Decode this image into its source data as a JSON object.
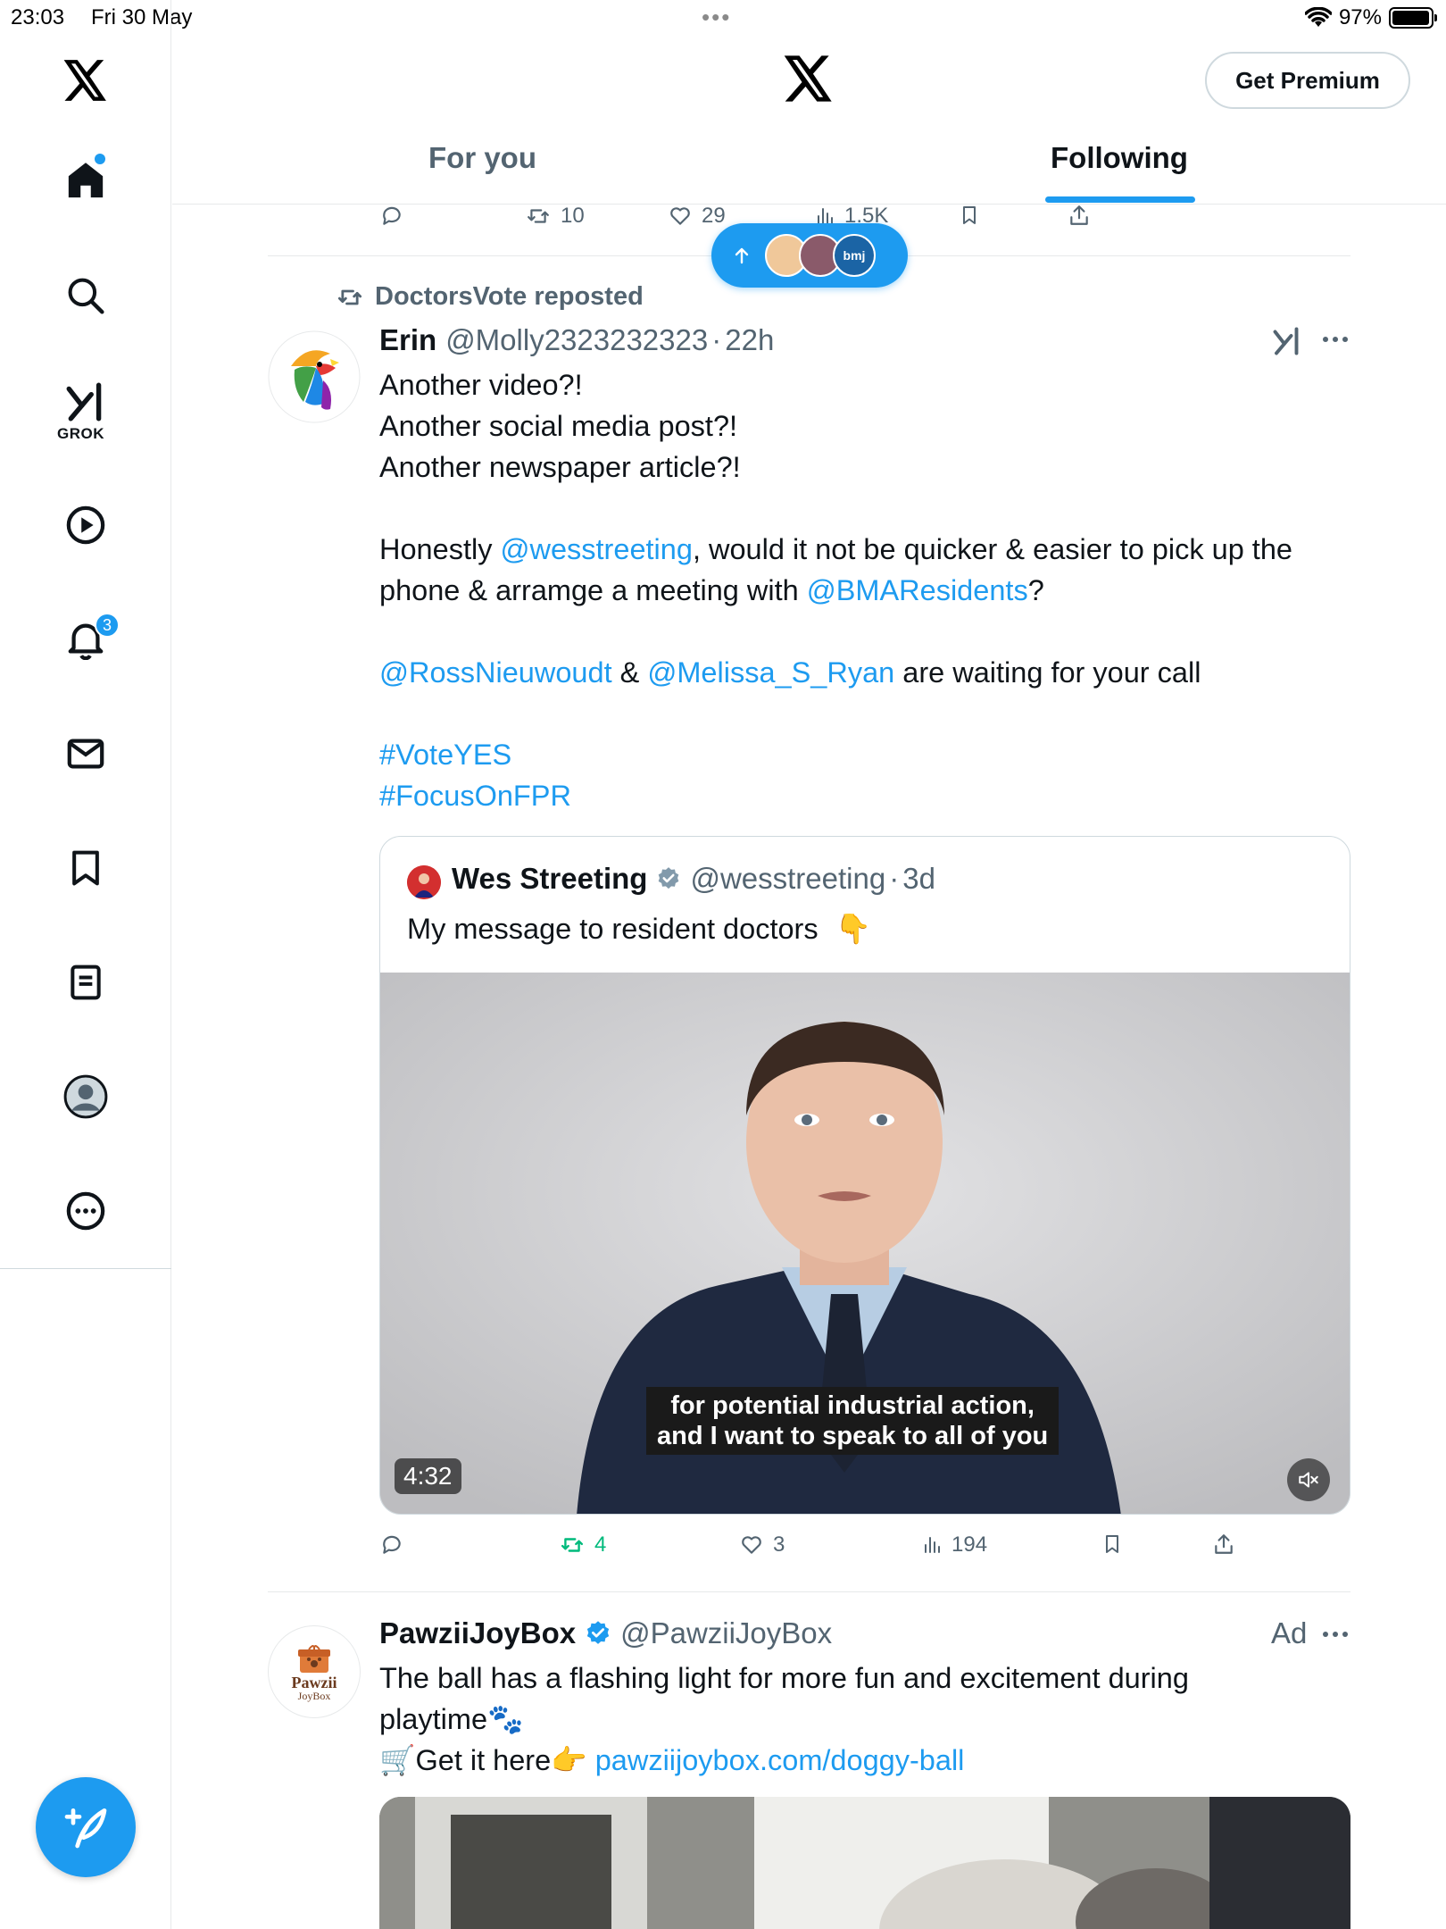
{
  "status_bar": {
    "time": "23:03",
    "date": "Fri 30 May",
    "dots": "•••",
    "battery": "97%",
    "battery_level": 0.97
  },
  "header": {
    "premium_label": "Get Premium",
    "tabs": [
      {
        "label": "For you",
        "active": false
      },
      {
        "label": "Following",
        "active": true
      }
    ]
  },
  "sidebar": {
    "grok_label": "GROK",
    "notifications_badge": "3",
    "items": [
      "home-icon",
      "search-icon",
      "grok-icon",
      "video-icon",
      "bell-icon",
      "mail-icon",
      "bookmark-icon",
      "lists-icon",
      "profile-icon",
      "more-icon"
    ]
  },
  "previous_post_actions": {
    "retweets": "10",
    "likes": "29",
    "views": "1.5K"
  },
  "new_posts_pill": {
    "avatar_text": "bmj"
  },
  "post1": {
    "repost_by": "DoctorsVote reposted",
    "name": "Erin",
    "handle": "@Molly2323232323",
    "sep": "·",
    "time": "22h",
    "lines": {
      "l1": "Another video?!",
      "l2": "Another social media post?!",
      "l3": "Another newspaper article?!",
      "p2a": "Honestly ",
      "mention1": "@wesstreeting",
      "p2b": ", would it not be quicker & easier to pick up the",
      "p2c": "phone & arramge a meeting with ",
      "mention2": "@BMAResidents",
      "p2d": "?",
      "mention3": "@RossNieuwoudt",
      "amp": " & ",
      "mention4": "@Melissa_S_Ryan",
      "p3": " are waiting for your call",
      "tag1": "#VoteYES",
      "tag2": "#FocusOnFPR"
    },
    "quote": {
      "name": "Wes Streeting",
      "handle": "@wesstreeting",
      "sep": "·",
      "time": "3d",
      "text": "My message to resident doctors",
      "emoji": "👇",
      "caption_l1": "for potential industrial action,",
      "caption_l2": "and I want to speak to all of you",
      "duration": "4:32"
    },
    "actions": {
      "retweets": "4",
      "likes": "3",
      "views": "194"
    }
  },
  "post2": {
    "name": "PawziiJoyBox",
    "handle": "@PawziiJoyBox",
    "ad_label": "Ad",
    "logo_text": "Pawzii",
    "logo_sub": "JoyBox",
    "line1": "The ball has a flashing light for more fun and excitement during",
    "line2": "playtime🐾",
    "line3a": "🛒Get it here👉 ",
    "link": "pawziijoybox.com/doggy-ball"
  },
  "colors": {
    "accent": "#1d9bf0",
    "text": "#0f1419",
    "secondary": "#536471",
    "repost_green": "#00ba7c"
  }
}
